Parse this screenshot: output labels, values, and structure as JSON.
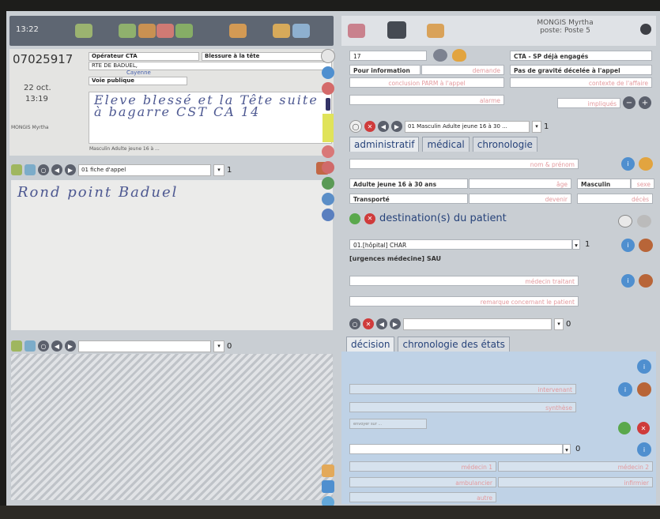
{
  "header": {
    "time": "13:22",
    "user_name": "MONGIS Myrtha",
    "station": "poste: Poste 5"
  },
  "call": {
    "number": "07025917",
    "operator_label": "Opérateur CTA",
    "motive": "Blessure à la tête",
    "street": "RTE DE BADUEL,",
    "city": "Cayenne",
    "road_type": "Voie publique",
    "date": "22 oct.",
    "time": "13:19",
    "author": "MONGIS Myrtha",
    "patient_desc": "Masculin Adulte jeune 16 à ...",
    "handwriting": "Eleve blessé et la Tête suite à bagarre CST CA 14"
  },
  "left_bar1": {
    "select": "01 fiche d'appel",
    "count": "1"
  },
  "notes_handwriting": "Rond point Baduel",
  "left_bar2": {
    "select": "",
    "count": "0"
  },
  "right": {
    "count_field": "17",
    "cta_status": "CTA - SP déjà engagés",
    "info_label": "Pour information",
    "demand_ph": "demande",
    "gravity": "Pas de gravité décelée à l'appel",
    "conclusion_ph": "conclusion PARM à l'appel",
    "alarme_ph": "alarme",
    "impliques_ph": "impliqués",
    "contexte_ph": "contexte de l'affaire",
    "patient_select": "01 Masculin Adulte jeune 16 à 30 ...",
    "patient_count": "1",
    "tabs": [
      "administratif",
      "médical",
      "chronologie"
    ],
    "name_ph": "nom & prénom",
    "age_value": "Adulte jeune 16 à 30 ans",
    "age_ph": "âge",
    "sex_value": "Masculin",
    "sex_ph": "sexe",
    "transport_value": "Transporté",
    "devenir_ph": "devenir",
    "deces_ph": "décès",
    "destination_title": "destination(s) du patient",
    "hospital_select": "01.[hôpital] CHAR",
    "hospital_count": "1",
    "service": "[urgences médecine] SAU",
    "medecin_ph": "médecin traitant",
    "remarque_ph": "remarque concernant le patient",
    "decision_count": "0",
    "decision_tabs": [
      "décision",
      "chronologie des états"
    ],
    "intervenant_ph": "intervenant",
    "synthese_ph": "synthèse",
    "small_field": "envoyer sur ...",
    "bottom_count": "0",
    "medecin1_ph": "médecin 1",
    "medecin2_ph": "médecin 2",
    "ambulancier_ph": "ambulancier",
    "infirmier_ph": "infirmier",
    "autre_ph": "autre"
  }
}
